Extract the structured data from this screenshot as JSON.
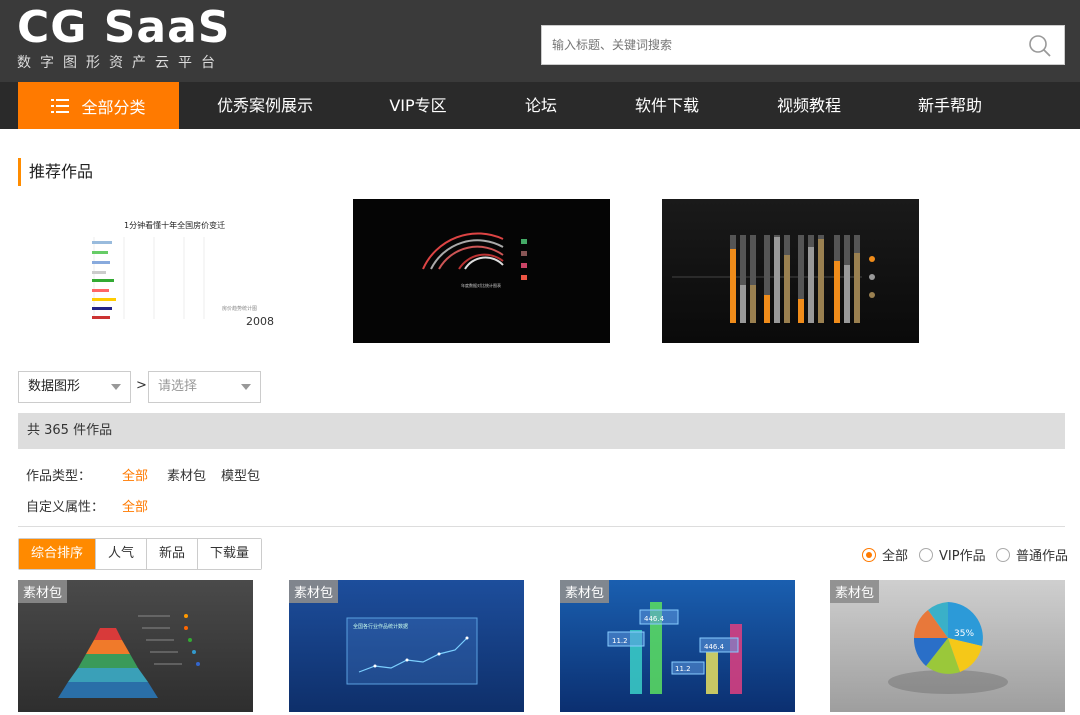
{
  "logo": {
    "title": "CG SaaS",
    "subtitle": "数字图形资产云平台"
  },
  "search": {
    "placeholder": "输入标题、关键词搜索"
  },
  "nav": {
    "all_label": "全部分类",
    "items": [
      "优秀案例展示",
      "VIP专区",
      "论坛",
      "软件下载",
      "视频教程",
      "新手帮助"
    ]
  },
  "recommended": {
    "title": "推荐作品",
    "thumb1_title": "1分钟看懂十年全国房价变迁",
    "thumb1_year": "2008",
    "thumb1_caption": "房价趋势统计图",
    "thumb2_caption": "年度数据对比统计图表"
  },
  "filters": {
    "dropdown1": "数据图形",
    "separator": ">",
    "dropdown2": "请选择",
    "count_text": "共 365 件作品",
    "type_label": "作品类型：",
    "type_options": [
      "全部",
      "素材包",
      "模型包"
    ],
    "custom_label": "自定义属性：",
    "custom_option": "全部"
  },
  "sort": {
    "tabs": [
      "综合排序",
      "人气",
      "新品",
      "下载量"
    ],
    "radios": [
      "全部",
      "VIP作品",
      "普通作品"
    ]
  },
  "cards": [
    {
      "badge": "素材包"
    },
    {
      "badge": "素材包",
      "title": "全国各行业作品统计数据"
    },
    {
      "badge": "素材包",
      "labels": [
        "446.4",
        "11.2",
        "446.4",
        "11.2"
      ]
    },
    {
      "badge": "素材包",
      "center": "35%"
    }
  ],
  "colors": {
    "accent": "#ff7a00",
    "topbar": "#3a3a3a",
    "nav": "#2a2a2a"
  }
}
